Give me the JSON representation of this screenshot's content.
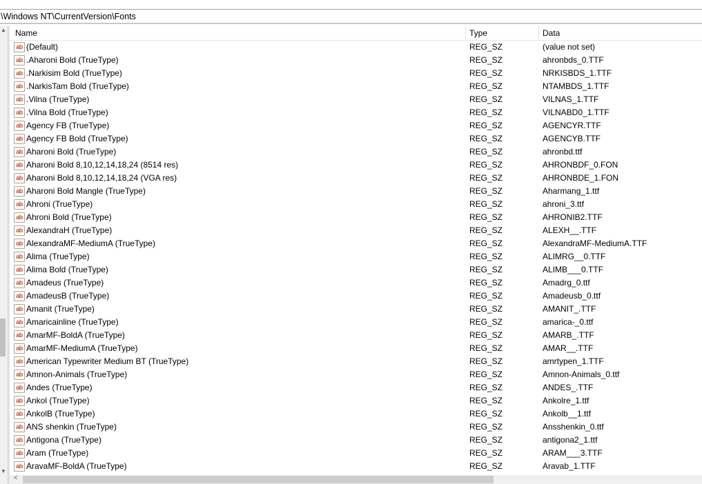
{
  "address": "\\Windows NT\\CurrentVersion\\Fonts",
  "columns": {
    "name": "Name",
    "type": "Type",
    "data": "Data"
  },
  "icon_label": "ab",
  "rows": [
    [
      "(Default)",
      "REG_SZ",
      "(value not set)"
    ],
    [
      ".Aharoni Bold (TrueType)",
      "REG_SZ",
      "ahronbds_0.TTF"
    ],
    [
      ".Narkisim Bold (TrueType)",
      "REG_SZ",
      "NRKISBDS_1.TTF"
    ],
    [
      ".NarkisTam Bold (TrueType)",
      "REG_SZ",
      "NTAMBDS_1.TTF"
    ],
    [
      ".Vilna (TrueType)",
      "REG_SZ",
      "VILNAS_1.TTF"
    ],
    [
      ".Vilna Bold (TrueType)",
      "REG_SZ",
      "VILNABD0_1.TTF"
    ],
    [
      "Agency FB (TrueType)",
      "REG_SZ",
      "AGENCYR.TTF"
    ],
    [
      "Agency FB Bold (TrueType)",
      "REG_SZ",
      "AGENCYB.TTF"
    ],
    [
      "Aharoni Bold (TrueType)",
      "REG_SZ",
      "ahronbd.ttf"
    ],
    [
      "Aharoni Bold 8,10,12,14,18,24 (8514 res)",
      "REG_SZ",
      "AHRONBDF_0.FON"
    ],
    [
      "Aharoni Bold 8,10,12,14,18,24 (VGA res)",
      "REG_SZ",
      "AHRONBDE_1.FON"
    ],
    [
      "Aharoni Bold Mangle (TrueType)",
      "REG_SZ",
      "Aharmang_1.ttf"
    ],
    [
      "Ahroni (TrueType)",
      "REG_SZ",
      "ahroni_3.ttf"
    ],
    [
      "Ahroni Bold (TrueType)",
      "REG_SZ",
      "AHRONIB2.TTF"
    ],
    [
      "AlexandraH (TrueType)",
      "REG_SZ",
      "ALEXH__.TTF"
    ],
    [
      "AlexandraMF-MediumA (TrueType)",
      "REG_SZ",
      "AlexandraMF-MediumA.TTF"
    ],
    [
      "Alima (TrueType)",
      "REG_SZ",
      "ALIMRG__0.TTF"
    ],
    [
      "Alima Bold (TrueType)",
      "REG_SZ",
      "ALIMB___0.TTF"
    ],
    [
      "Amadeus (TrueType)",
      "REG_SZ",
      "Amadrg_0.ttf"
    ],
    [
      "AmadeusB (TrueType)",
      "REG_SZ",
      "Amadeusb_0.ttf"
    ],
    [
      "Amanit (TrueType)",
      "REG_SZ",
      "AMANIT_.TTF"
    ],
    [
      "Amaricainline (TrueType)",
      "REG_SZ",
      "amarica-_0.ttf"
    ],
    [
      "AmarMF-BoldA (TrueType)",
      "REG_SZ",
      "AMARB_.TTF"
    ],
    [
      "AmarMF-MediumA (TrueType)",
      "REG_SZ",
      "AMAR__.TTF"
    ],
    [
      "American Typewriter Medium BT (TrueType)",
      "REG_SZ",
      "amrtypen_1.TTF"
    ],
    [
      "Amnon-Animals (TrueType)",
      "REG_SZ",
      "Amnon-Animals_0.ttf"
    ],
    [
      "Andes (TrueType)",
      "REG_SZ",
      "ANDES_.TTF"
    ],
    [
      "Ankol (TrueType)",
      "REG_SZ",
      "Ankolre_1.ttf"
    ],
    [
      "AnkolB (TrueType)",
      "REG_SZ",
      "Ankolb__1.ttf"
    ],
    [
      "ANS shenkin (TrueType)",
      "REG_SZ",
      "Ansshenkin_0.ttf"
    ],
    [
      "Antigona (TrueType)",
      "REG_SZ",
      "antigona2_1.ttf"
    ],
    [
      "Aram (TrueType)",
      "REG_SZ",
      "ARAM___3.TTF"
    ],
    [
      "AravaMF-BoldA (TrueType)",
      "REG_SZ",
      "Aravab_1.TTF"
    ]
  ]
}
